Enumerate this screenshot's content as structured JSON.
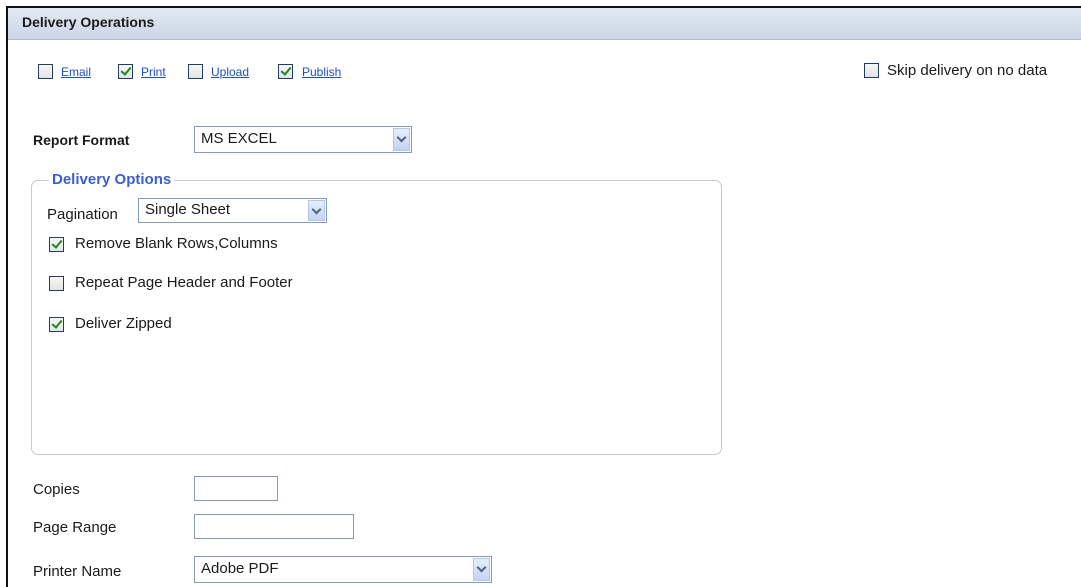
{
  "header": {
    "title": "Delivery Operations"
  },
  "operations": [
    {
      "label": "Email",
      "checked": false
    },
    {
      "label": "Print",
      "checked": true
    },
    {
      "label": "Upload",
      "checked": false
    },
    {
      "label": "Publish",
      "checked": true
    }
  ],
  "skip_delivery": {
    "label": "Skip delivery on no data",
    "checked": false
  },
  "report_format": {
    "label": "Report Format",
    "value": "MS EXCEL"
  },
  "delivery_options": {
    "legend": "Delivery Options",
    "pagination": {
      "label": "Pagination",
      "value": "Single Sheet"
    },
    "remove_blank": {
      "label": "Remove Blank Rows,Columns",
      "checked": true
    },
    "repeat_header": {
      "label": "Repeat Page Header and Footer",
      "checked": false
    },
    "deliver_zipped": {
      "label": "Deliver Zipped",
      "checked": true
    }
  },
  "copies": {
    "label": "Copies",
    "value": ""
  },
  "page_range": {
    "label": "Page Range",
    "value": ""
  },
  "printer_name": {
    "label": "Printer Name",
    "value": "Adobe PDF"
  }
}
